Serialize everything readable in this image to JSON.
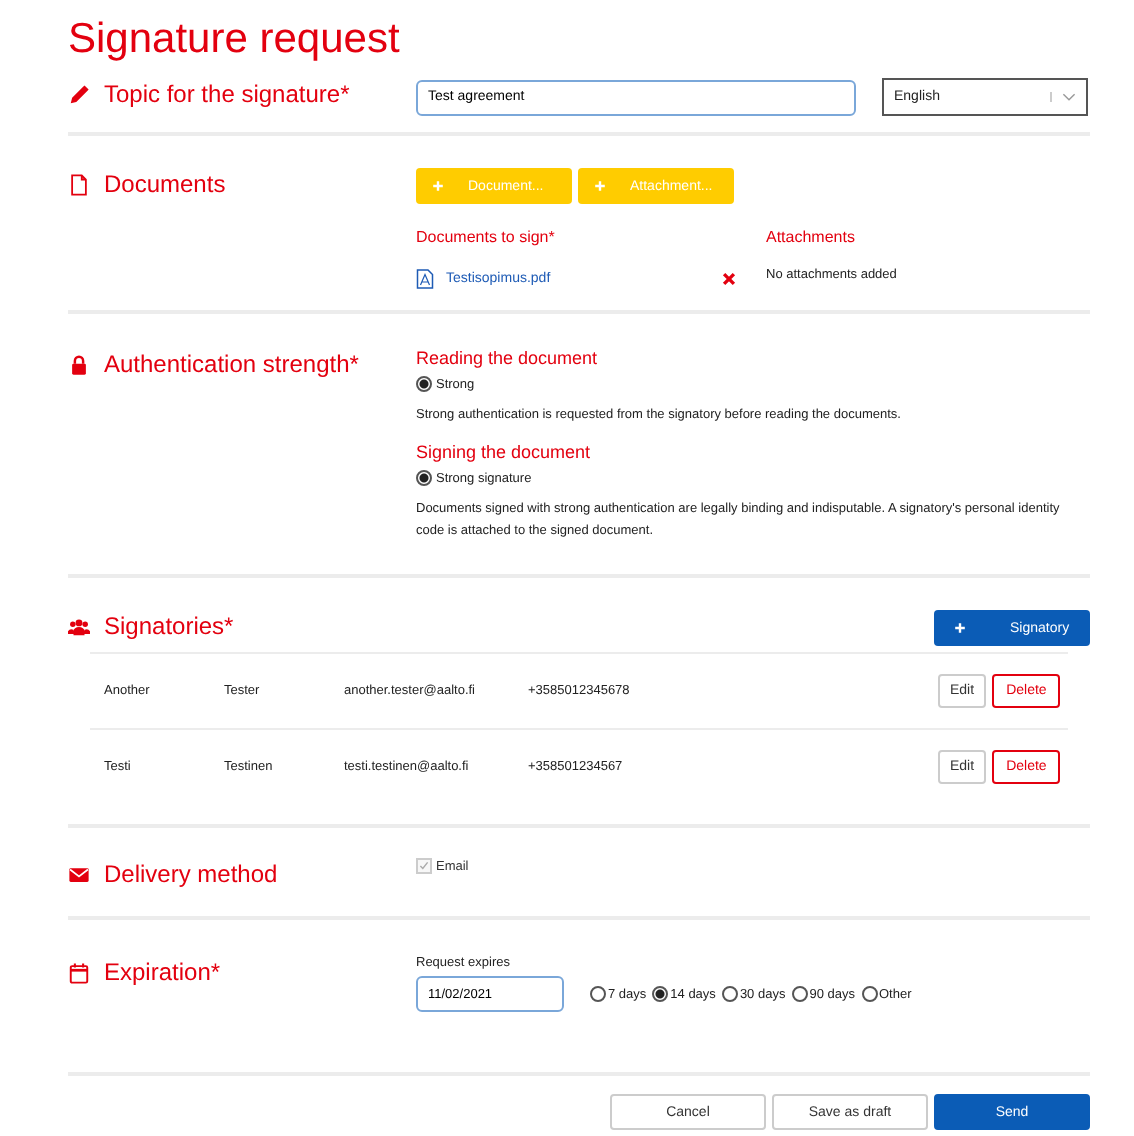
{
  "title": "Signature request",
  "topic": {
    "label": "Topic for the signature*",
    "value": "Test agreement",
    "language": "English"
  },
  "documents": {
    "label": "Documents",
    "buttons": [
      {
        "label": "Document..."
      },
      {
        "label": "Attachment..."
      }
    ],
    "to_sign_heading": "Documents to sign*",
    "attachments_heading": "Attachments",
    "files": [
      {
        "name": "Testisopimus.pdf"
      }
    ],
    "attachments_empty": "No attachments added"
  },
  "authentication": {
    "label": "Authentication strength*",
    "groups": [
      {
        "heading": "Reading the document",
        "option": "Strong",
        "selected": true,
        "description": "Strong authentication is requested from the signatory before reading the documents."
      },
      {
        "heading": "Signing the document",
        "option": "Strong signature",
        "selected": true,
        "description": "Documents signed with strong authentication are legally binding and indisputable. A signatory's personal identity code is attached to the signed document."
      }
    ]
  },
  "signatories": {
    "label": "Signatories*",
    "add_button": "Signatory",
    "rows": [
      {
        "first": "Another",
        "last": "Tester",
        "email": "another.tester@aalto.fi",
        "phone": "+3585012345678",
        "edit": "Edit",
        "delete": "Delete"
      },
      {
        "first": "Testi",
        "last": "Testinen",
        "email": "testi.testinen@aalto.fi",
        "phone": "+358501234567",
        "edit": "Edit",
        "delete": "Delete"
      }
    ]
  },
  "delivery": {
    "label": "Delivery method",
    "option": "Email",
    "checked": true,
    "disabled": true
  },
  "expiration": {
    "label": "Expiration*",
    "field_label": "Request expires",
    "value": "11/02/2021",
    "options": [
      {
        "label": "7 days",
        "selected": false
      },
      {
        "label": "14 days",
        "selected": true
      },
      {
        "label": "30 days",
        "selected": false
      },
      {
        "label": "90 days",
        "selected": false
      },
      {
        "label": "Other",
        "selected": false
      }
    ]
  },
  "footer_buttons": [
    {
      "label": "Cancel",
      "kind": "secondary"
    },
    {
      "label": "Save as draft",
      "kind": "secondary"
    },
    {
      "label": "Send",
      "kind": "primary"
    }
  ]
}
